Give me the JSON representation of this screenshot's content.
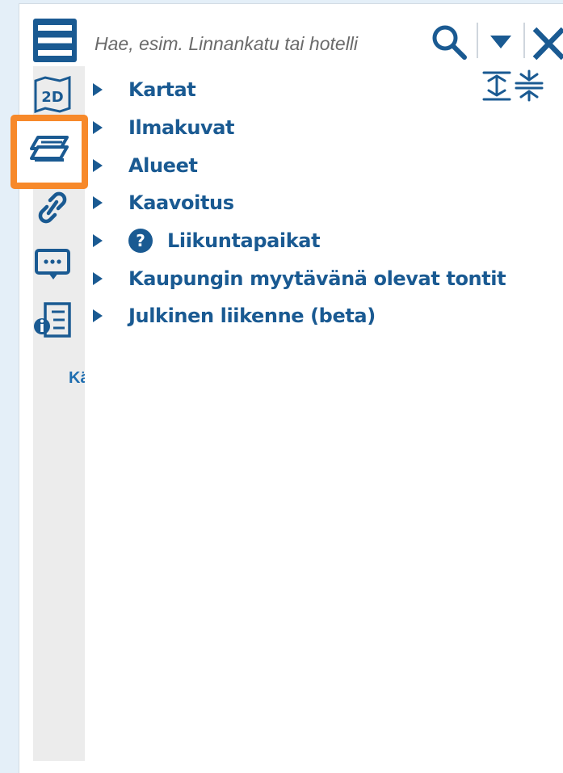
{
  "search": {
    "placeholder": "Hae, esim. Linnankatu tai hotelli"
  },
  "icons": {
    "menu": "hamburger-menu-icon",
    "map2d": "map-2d-icon",
    "layers": "layers-icon",
    "link": "link-icon",
    "feedback": "speech-bubble-icon",
    "info": "info-list-icon",
    "search": "search-icon",
    "dropdown": "caret-down-icon",
    "close": "close-icon",
    "expand_all": "expand-all-icon",
    "collapse_all": "collapse-all-icon",
    "help": "question-icon"
  },
  "sidebar": {
    "map2d_label": "2D",
    "caption": "Kä"
  },
  "layer_tree": {
    "items": [
      {
        "label": "Kartat",
        "help": false
      },
      {
        "label": "Ilmakuvat",
        "help": false
      },
      {
        "label": "Alueet",
        "help": false
      },
      {
        "label": "Kaavoitus",
        "help": false
      },
      {
        "label": "Liikuntapaikat",
        "help": true
      },
      {
        "label": "Kaupungin myytävänä olevat tontit",
        "help": false
      },
      {
        "label": "Julkinen liikenne (beta)",
        "help": false
      }
    ],
    "help_glyph": "?"
  },
  "colors": {
    "primary": "#1a5a92",
    "accent_link": "#1f6eb0",
    "highlight": "#f7892a",
    "sidebar_bg": "#ececec",
    "page_bg": "#e4eff8"
  }
}
